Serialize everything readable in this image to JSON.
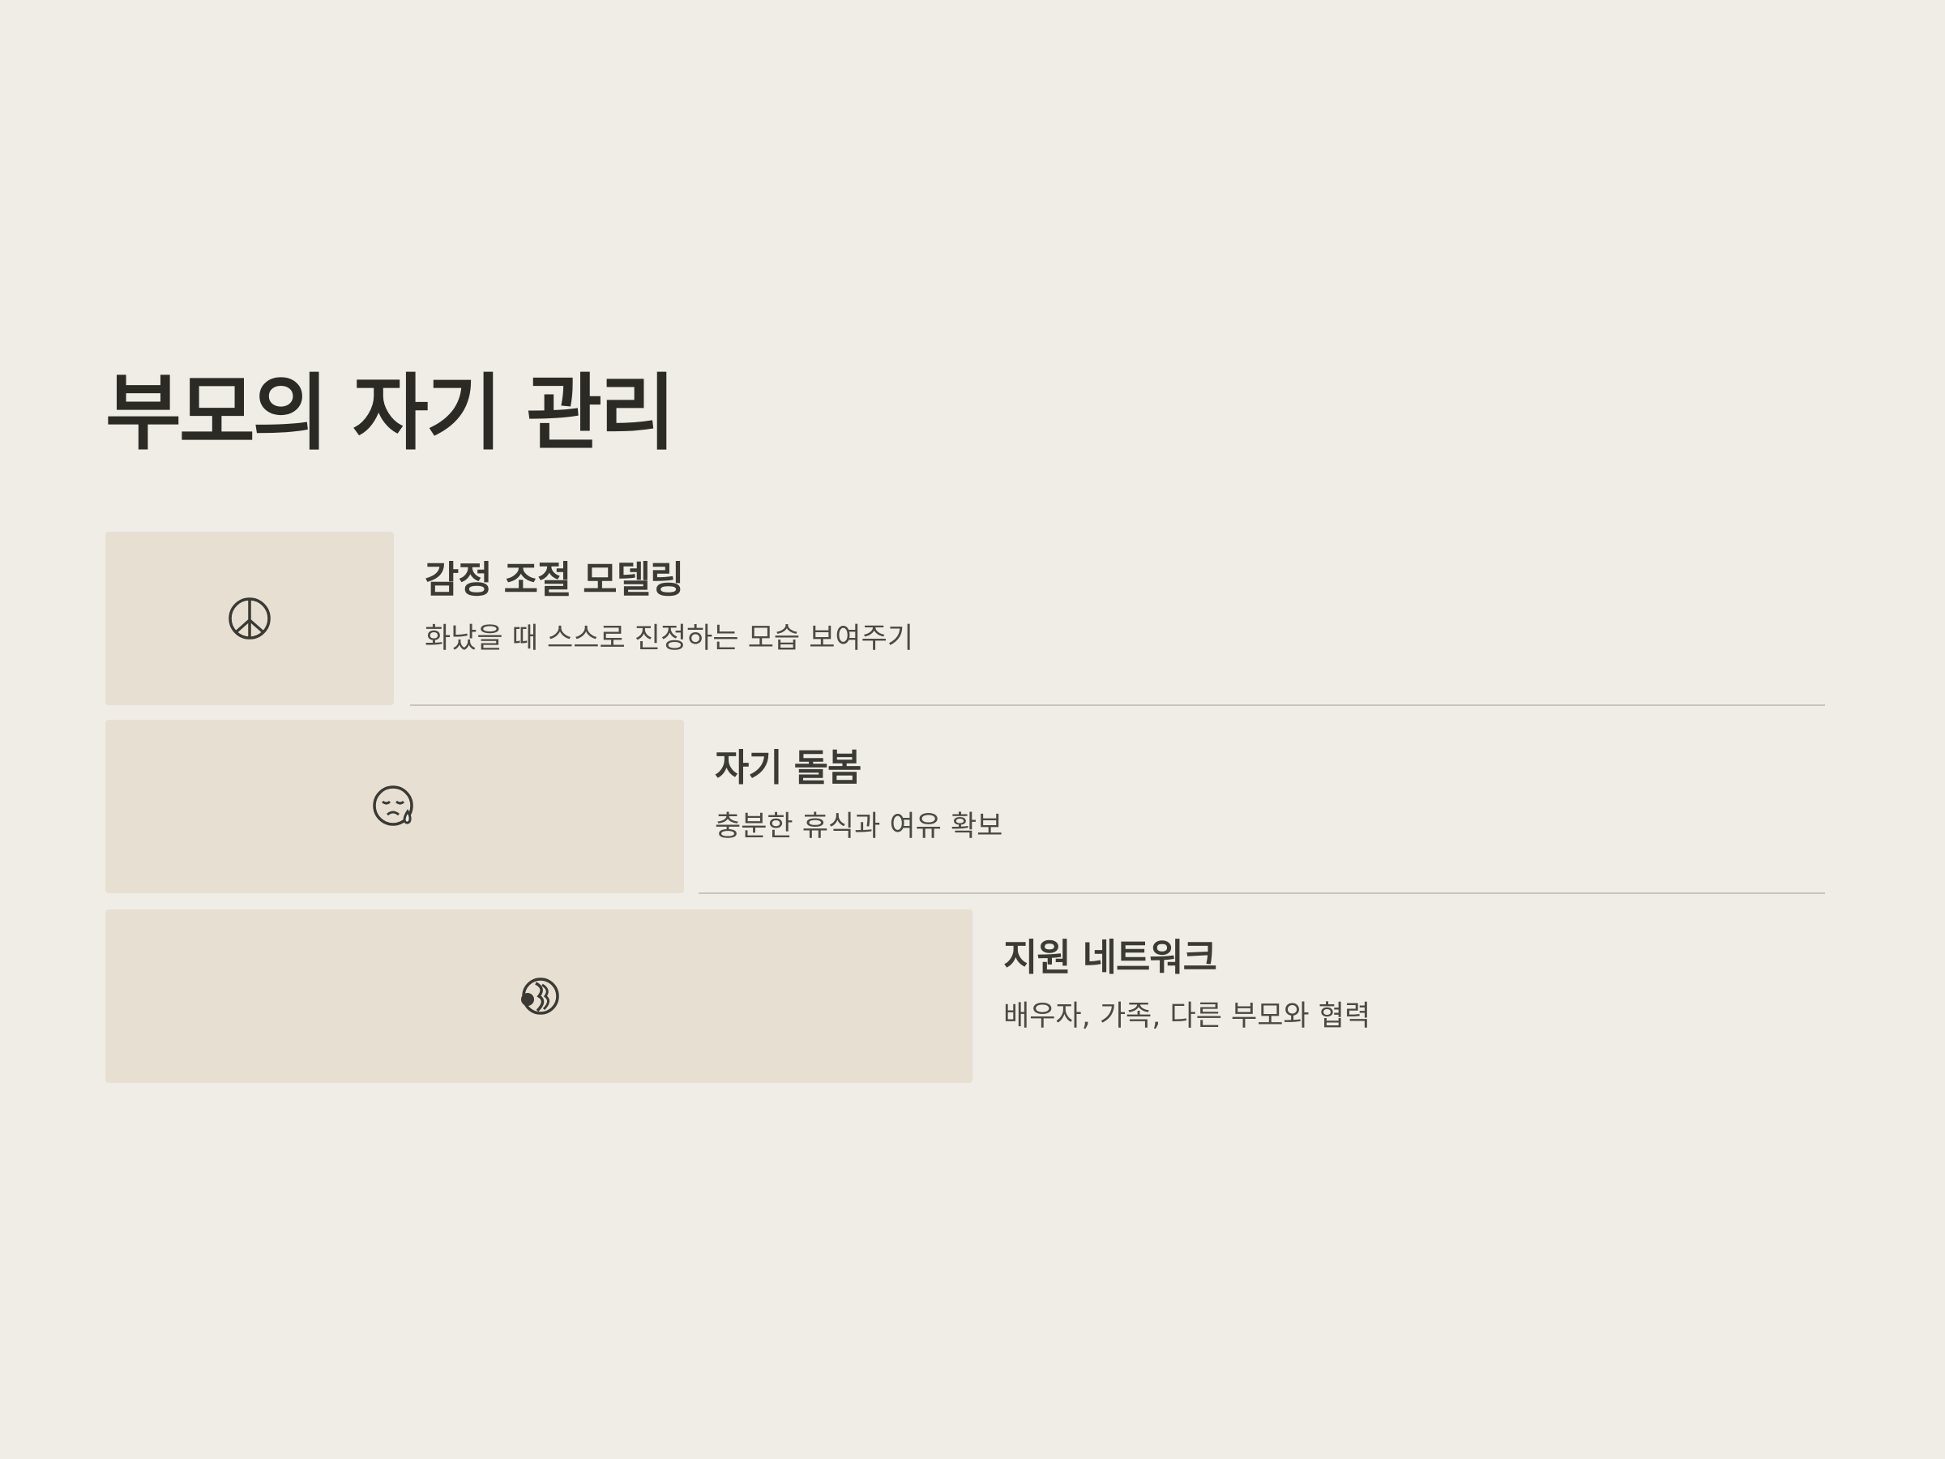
{
  "title": "부모의 자기 관리",
  "items": [
    {
      "icon": "peace-icon",
      "title": "감정 조절 모델링",
      "description": "화났을 때 스스로 진정하는 모습 보여주기"
    },
    {
      "icon": "sleepy-face-icon",
      "title": "자기 돌봄",
      "description": "충분한 휴식과 여유 확보"
    },
    {
      "icon": "people-hugging-icon",
      "title": "지원 네트워크",
      "description": "배우자, 가족, 다른 부모와 협력"
    }
  ],
  "colors": {
    "background": "#f0ede6",
    "icon_box": "#e6dfd2",
    "text": "#2e2d28",
    "divider": "#c9c5bc"
  }
}
